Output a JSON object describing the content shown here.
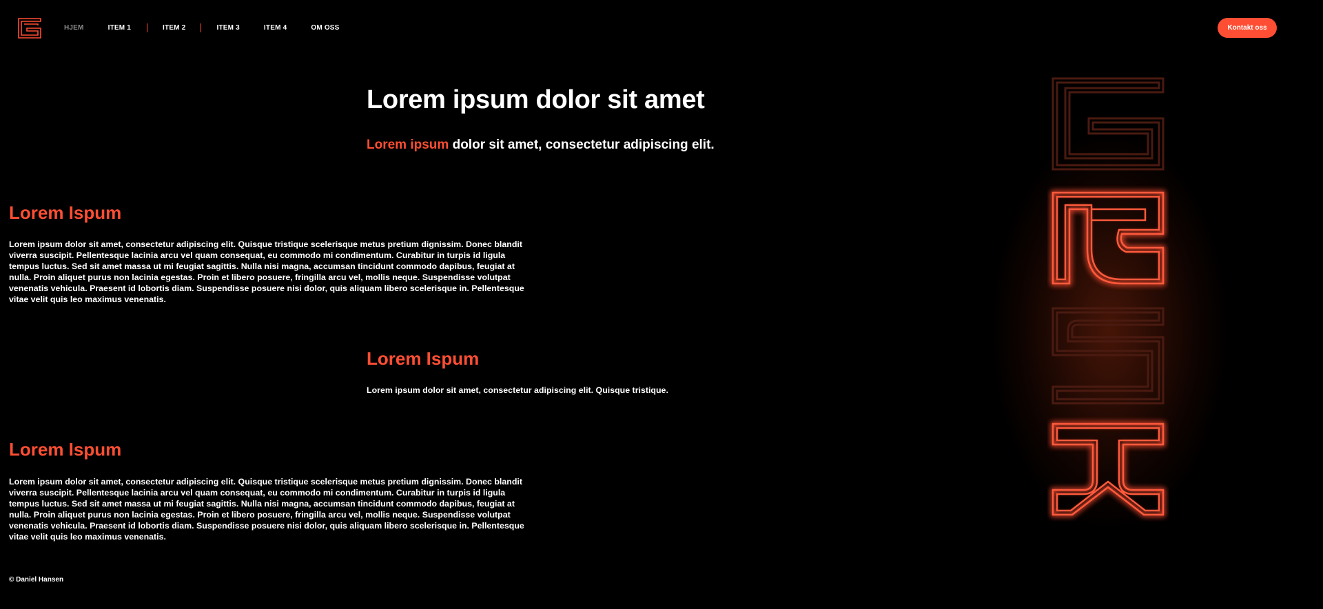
{
  "header": {
    "logo_icon": "g-logo-icon",
    "nav": [
      {
        "label": "HJEM",
        "active": true
      },
      {
        "label": "ITEM 1"
      },
      {
        "label": "ITEM 2"
      },
      {
        "label": "ITEM 3"
      },
      {
        "label": "ITEM 4"
      },
      {
        "label": "OM OSS"
      }
    ],
    "contact_label": "Kontakt oss"
  },
  "hero": {
    "title": "Lorem ipsum dolor sit amet",
    "subtitle_accent": "Lorem ipsum",
    "subtitle_rest": " dolor sit amet, consectetur adipiscing elit."
  },
  "sections": [
    {
      "title": "Lorem Ispum",
      "body": "Lorem ipsum dolor sit amet, consectetur adipiscing elit. Quisque tristique scelerisque metus pretium dignissim. Donec blandit viverra suscipit. Pellentesque lacinia arcu vel quam consequat, eu commodo mi condimentum. Curabitur in turpis id ligula tempus luctus. Sed sit amet massa ut mi feugiat sagittis. Nulla nisi magna, accumsan tincidunt commodo dapibus, feugiat at nulla. Proin aliquet purus non lacinia egestas. Proin et libero posuere, fringilla arcu vel, mollis neque. Suspendisse volutpat venenatis vehicula. Praesent id lobortis diam. Suspendisse posuere nisi dolor, quis aliquam libero scelerisque in. Pellentesque vitae velit quis leo maximus venenatis."
    },
    {
      "title": "Lorem Ispum",
      "body": "Lorem ipsum dolor sit amet, consectetur adipiscing elit. Quisque tristique."
    },
    {
      "title": "Lorem Ispum",
      "body": "Lorem ipsum dolor sit amet, consectetur adipiscing elit. Quisque tristique scelerisque metus pretium dignissim. Donec blandit viverra suscipit. Pellentesque lacinia arcu vel quam consequat, eu commodo mi condimentum. Curabitur in turpis id ligula tempus luctus. Sed sit amet massa ut mi feugiat sagittis. Nulla nisi magna, accumsan tincidunt commodo dapibus, feugiat at nulla. Proin aliquet purus non lacinia egestas. Proin et libero posuere, fringilla arcu vel, mollis neque. Suspendisse volutpat venenatis vehicula. Praesent id lobortis diam. Suspendisse posuere nisi dolor, quis aliquam libero scelerisque in. Pellentesque vitae velit quis leo maximus venenatis."
    }
  ],
  "footer": {
    "copyright": "© Daniel Hansen"
  },
  "art": {
    "name": "neon-letters-graphic",
    "letters": [
      "G",
      "R",
      "S",
      "K"
    ],
    "accent": "#ff4e33",
    "dim": "#4a1a10"
  },
  "colors": {
    "accent": "#ff4e33",
    "background": "#000000",
    "text": "#ffffff",
    "nav_active": "#8a8a8a"
  }
}
